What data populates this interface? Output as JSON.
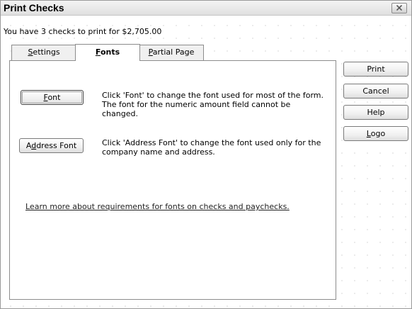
{
  "window": {
    "title": "Print Checks"
  },
  "summary": "You have 3 checks to print for $2,705.00",
  "tabs": [
    {
      "label": "Settings",
      "accel": "S",
      "rest": "ettings"
    },
    {
      "label": "Fonts",
      "accel": "F",
      "rest": "onts"
    },
    {
      "label": "Partial Page",
      "accel": "P",
      "rest": "artial Page"
    }
  ],
  "fonts_tab": {
    "font_button": {
      "pre": "",
      "accel": "F",
      "post": "ont"
    },
    "font_desc": "Click 'Font' to change the font used for most of the form. The font for the numeric amount field cannot be changed.",
    "address_button": {
      "pre": "A",
      "accel": "d",
      "post": "dress Font"
    },
    "address_desc": "Click 'Address Font' to change the font used only for the company name and address.",
    "learn_link": "Learn more about requirements for fonts on checks and paychecks."
  },
  "side_buttons": {
    "print": "Print",
    "cancel": "Cancel",
    "help": "Help",
    "logo": {
      "pre": "",
      "accel": "L",
      "post": "ogo"
    }
  }
}
